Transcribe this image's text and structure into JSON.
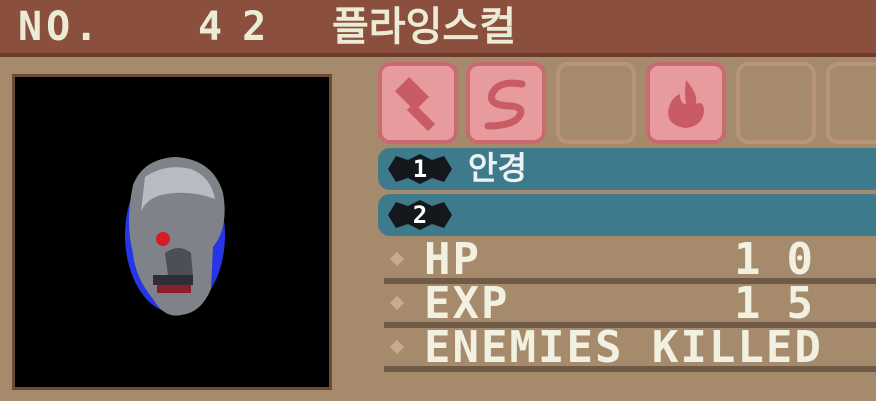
{
  "header": {
    "no_label": "NO.",
    "number": "42",
    "name": "플라잉스컬"
  },
  "portrait": {
    "icon": "skull"
  },
  "weakness_slots": [
    {
      "icon": "hammer-icon"
    },
    {
      "icon": "whip-icon"
    },
    {
      "icon": ""
    },
    {
      "icon": "fire-icon"
    },
    {
      "icon": ""
    },
    {
      "icon": ""
    }
  ],
  "drops": [
    {
      "index": "1",
      "item": "안경"
    },
    {
      "index": "2",
      "item": ""
    }
  ],
  "stats": [
    {
      "label": "HP",
      "value": "10"
    },
    {
      "label": "EXP",
      "value": "15"
    },
    {
      "label": "ENEMIES KILLED",
      "value": ""
    }
  ],
  "colors": {
    "header": "#8a4f3d",
    "panel": "#a58a6c",
    "slot_active": "#e79b9e",
    "drop_bar": "#3d7b8c",
    "text": "#f1f0e1"
  }
}
